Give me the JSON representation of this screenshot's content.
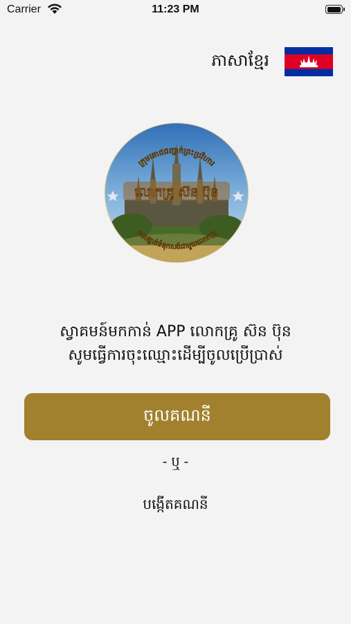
{
  "status_bar": {
    "carrier": "Carrier",
    "time": "11:23 PM",
    "battery_level": 0.95
  },
  "language": {
    "label": "ភាសាខ្មែរ",
    "flag_icon": "cambodia-flag-icon"
  },
  "logo": {
    "icon": "angkor-wat-logo-icon",
    "top_arc_text": "ក្រុមគោជជញ្ជាក់ព្រះប្រវិហារ",
    "center_text": "លោកគ្រូ ស៊ន ប៊ុន",
    "bottom_arc_text": "ការបង្ហាត់ទំនុកសង់ជាមួយលោកគ្រូ"
  },
  "welcome": {
    "line1": "ស្វាគមន៍មកកាន់ APP លោកគ្រូ ស៊ន ប៊ុន",
    "line2": "សូមធ្វើការចុះឈ្មោះដើម្បីចូលប្រើប្រាស់"
  },
  "login_button": {
    "label": "ចូលគណនី"
  },
  "or_text": "- ឬ -",
  "register_link": {
    "label": "បង្កើតគណនី"
  },
  "colors": {
    "accent": "#a1812d",
    "background": "#f3f3f3",
    "flag_blue": "#032ea1",
    "flag_red": "#e00025"
  }
}
